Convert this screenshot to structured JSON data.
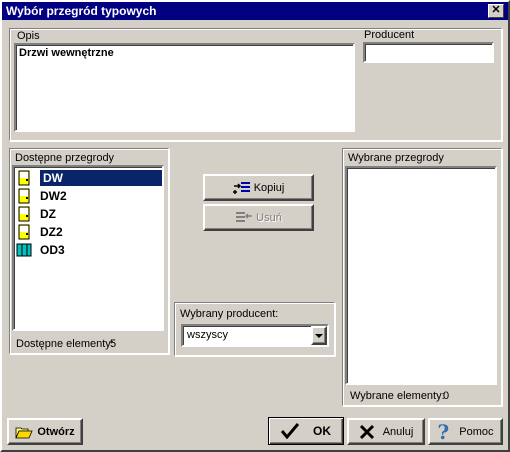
{
  "window": {
    "title": "Wybór przegród typowych",
    "close_glyph": "✕"
  },
  "opis": {
    "label": "Opis",
    "value": "Drzwi wewnętrzne"
  },
  "producent": {
    "label": "Producent",
    "value": ""
  },
  "available": {
    "label": "Dostępne przegrody",
    "items": [
      {
        "name": "DW",
        "icon": "door-icon",
        "selected": true
      },
      {
        "name": "DW2",
        "icon": "door-icon",
        "selected": false
      },
      {
        "name": "DZ",
        "icon": "door-icon",
        "selected": false
      },
      {
        "name": "DZ2",
        "icon": "door-icon",
        "selected": false
      },
      {
        "name": "OD3",
        "icon": "window-icon",
        "selected": false
      }
    ],
    "count_label": "Dostępne elementy:",
    "count": "5"
  },
  "buttons": {
    "copy": "Kopiuj",
    "remove": "Usuń",
    "open": "Otwórz",
    "ok": "OK",
    "cancel": "Anuluj",
    "help": "Pomoc"
  },
  "producer_filter": {
    "label": "Wybrany producent:",
    "value": "wszyscy"
  },
  "selected": {
    "label": "Wybrane przegrody",
    "count_label": "Wybrane elementy:",
    "count": "0"
  },
  "colors": {
    "titlebar": "#000080",
    "selection": "#0a246a",
    "door_yellow": "#ffff00",
    "window_cyan": "#00c0c0"
  }
}
